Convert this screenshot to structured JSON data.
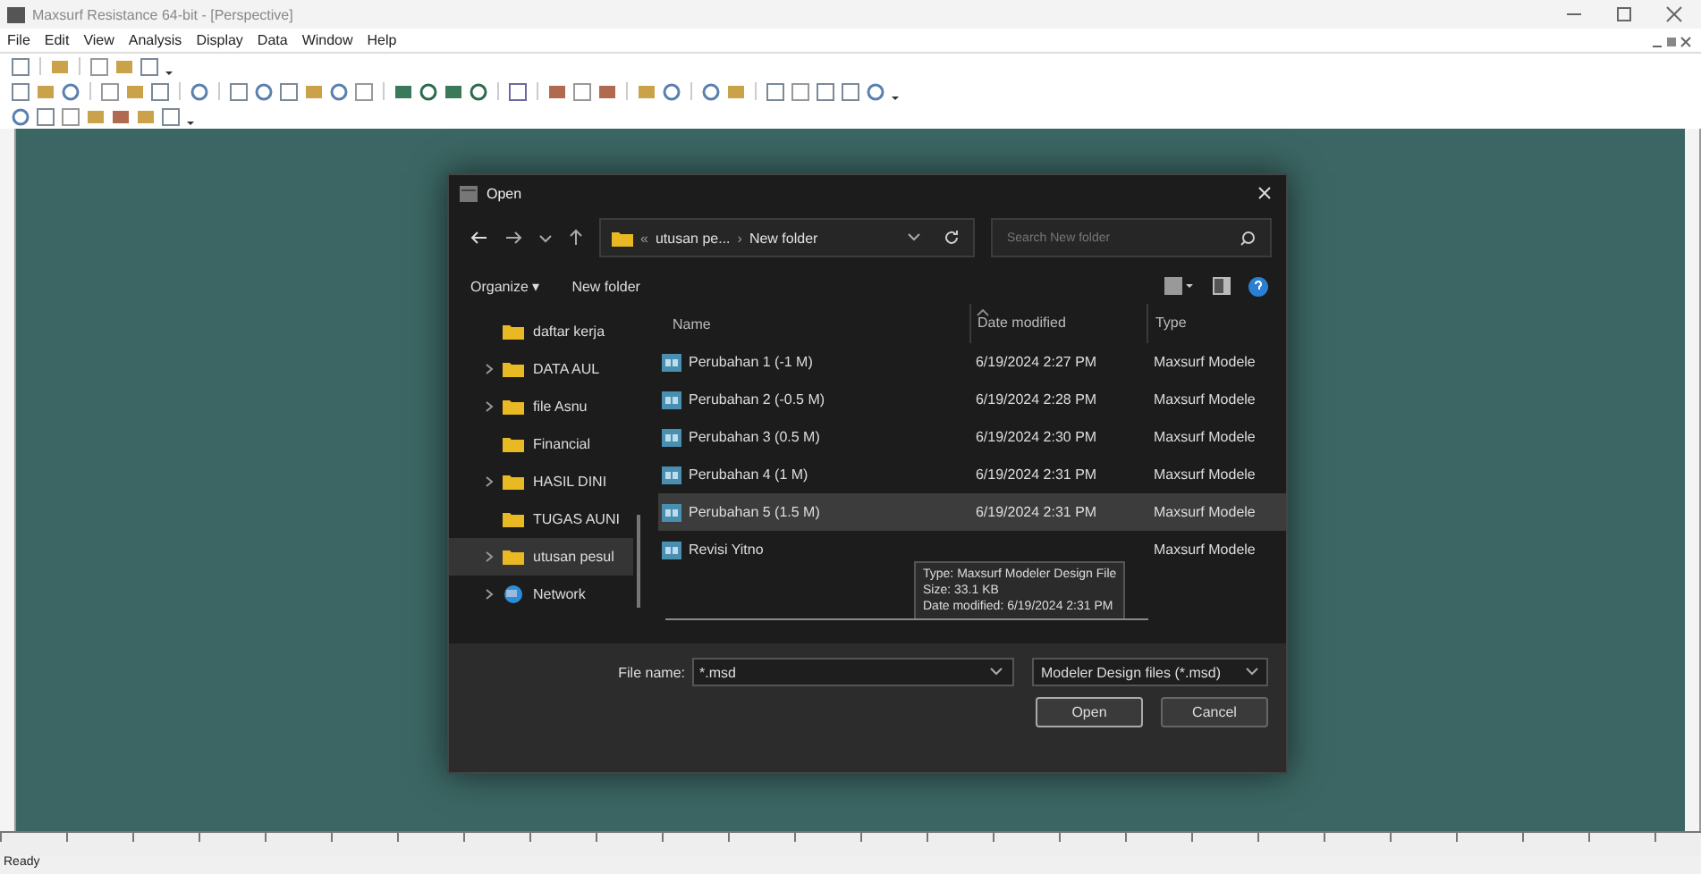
{
  "window": {
    "title": "Maxsurf Resistance 64-bit - [Perspective]"
  },
  "menu": [
    "File",
    "Edit",
    "View",
    "Analysis",
    "Display",
    "Data",
    "Window",
    "Help"
  ],
  "dialog": {
    "title": "Open",
    "breadcrumb": {
      "prefix": "«",
      "parent": "utusan pe...",
      "separator": "›",
      "current": "New folder"
    },
    "search": {
      "placeholder": "Search New folder"
    },
    "commands": [
      "Organize ▾",
      "New folder"
    ],
    "sidebar": [
      {
        "label": "daftar kerja",
        "kind": "folder",
        "expandable": false,
        "selected": false
      },
      {
        "label": "DATA AUL",
        "kind": "folder",
        "expandable": true,
        "selected": false
      },
      {
        "label": "file Asnu",
        "kind": "folder",
        "expandable": true,
        "selected": false
      },
      {
        "label": "Financial",
        "kind": "folder",
        "expandable": false,
        "selected": false
      },
      {
        "label": "HASIL DINI",
        "kind": "folder",
        "expandable": true,
        "selected": false
      },
      {
        "label": "TUGAS AUNI",
        "kind": "folder",
        "expandable": false,
        "selected": false
      },
      {
        "label": "utusan pesul",
        "kind": "folder",
        "expandable": true,
        "selected": true
      },
      {
        "label": "Network",
        "kind": "network",
        "expandable": true,
        "selected": false
      }
    ],
    "columns": [
      "Name",
      "Date modified",
      "Type"
    ],
    "files": [
      {
        "name": "Perubahan 1 (-1 M)",
        "date": "6/19/2024 2:27 PM",
        "type": "Maxsurf Modele",
        "selected": false
      },
      {
        "name": "Perubahan 2 (-0.5 M)",
        "date": "6/19/2024 2:28 PM",
        "type": "Maxsurf Modele",
        "selected": false
      },
      {
        "name": "Perubahan 3 (0.5 M)",
        "date": "6/19/2024 2:30 PM",
        "type": "Maxsurf Modele",
        "selected": false
      },
      {
        "name": "Perubahan 4 (1 M)",
        "date": "6/19/2024 2:31 PM",
        "type": "Maxsurf Modele",
        "selected": false
      },
      {
        "name": "Perubahan 5 (1.5 M)",
        "date": "6/19/2024 2:31 PM",
        "type": "Maxsurf Modele",
        "selected": true
      },
      {
        "name": "Revisi Yitno",
        "type": "Maxsurf Modele",
        "selected": false
      }
    ],
    "tooltip": [
      "Type: Maxsurf Modeler Design File",
      "Size: 33.1 KB",
      "Date modified: 6/19/2024 2:31 PM"
    ],
    "file_name": {
      "label": "File name:",
      "value": "*.msd"
    },
    "filter": "Modeler Design files (*.msd)",
    "buttons": [
      "Open",
      "Cancel"
    ]
  },
  "status_bar": "Ready"
}
